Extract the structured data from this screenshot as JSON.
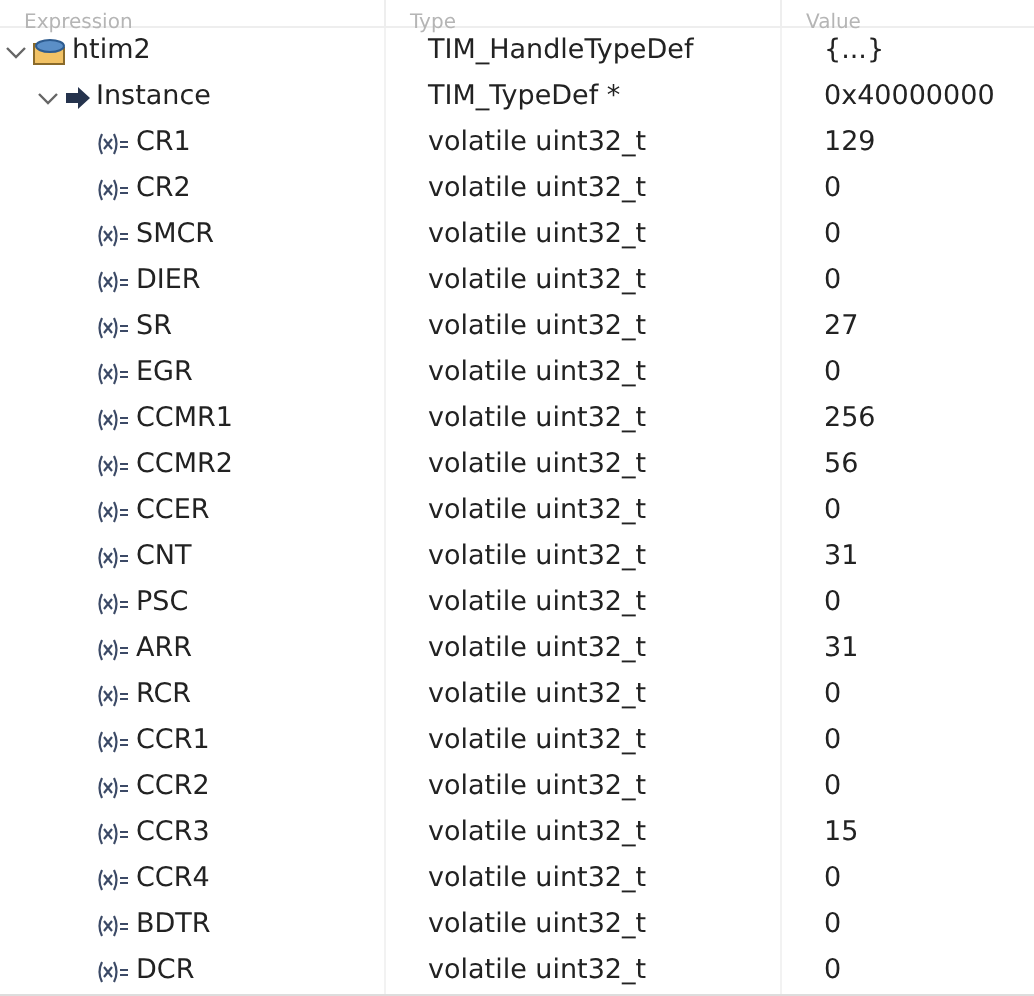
{
  "columns": [
    "Expression",
    "Type",
    "Value"
  ],
  "tree": [
    {
      "kind": "struct",
      "name": "htim2",
      "type": "TIM_HandleTypeDef",
      "value": "{...}",
      "expanded": true,
      "children": [
        {
          "kind": "pointer",
          "name": "Instance",
          "type": "TIM_TypeDef *",
          "value": "0x40000000",
          "expanded": true,
          "children": [
            {
              "kind": "variable",
              "name": "CR1",
              "type": "volatile uint32_t",
              "value": "129"
            },
            {
              "kind": "variable",
              "name": "CR2",
              "type": "volatile uint32_t",
              "value": "0"
            },
            {
              "kind": "variable",
              "name": "SMCR",
              "type": "volatile uint32_t",
              "value": "0"
            },
            {
              "kind": "variable",
              "name": "DIER",
              "type": "volatile uint32_t",
              "value": "0"
            },
            {
              "kind": "variable",
              "name": "SR",
              "type": "volatile uint32_t",
              "value": "27"
            },
            {
              "kind": "variable",
              "name": "EGR",
              "type": "volatile uint32_t",
              "value": "0"
            },
            {
              "kind": "variable",
              "name": "CCMR1",
              "type": "volatile uint32_t",
              "value": "256"
            },
            {
              "kind": "variable",
              "name": "CCMR2",
              "type": "volatile uint32_t",
              "value": "56"
            },
            {
              "kind": "variable",
              "name": "CCER",
              "type": "volatile uint32_t",
              "value": "0"
            },
            {
              "kind": "variable",
              "name": "CNT",
              "type": "volatile uint32_t",
              "value": "31"
            },
            {
              "kind": "variable",
              "name": "PSC",
              "type": "volatile uint32_t",
              "value": "0"
            },
            {
              "kind": "variable",
              "name": "ARR",
              "type": "volatile uint32_t",
              "value": "31"
            },
            {
              "kind": "variable",
              "name": "RCR",
              "type": "volatile uint32_t",
              "value": "0"
            },
            {
              "kind": "variable",
              "name": "CCR1",
              "type": "volatile uint32_t",
              "value": "0"
            },
            {
              "kind": "variable",
              "name": "CCR2",
              "type": "volatile uint32_t",
              "value": "0"
            },
            {
              "kind": "variable",
              "name": "CCR3",
              "type": "volatile uint32_t",
              "value": "15"
            },
            {
              "kind": "variable",
              "name": "CCR4",
              "type": "volatile uint32_t",
              "value": "0"
            },
            {
              "kind": "variable",
              "name": "BDTR",
              "type": "volatile uint32_t",
              "value": "0"
            },
            {
              "kind": "variable",
              "name": "DCR",
              "type": "volatile uint32_t",
              "value": "0"
            }
          ]
        }
      ]
    }
  ]
}
